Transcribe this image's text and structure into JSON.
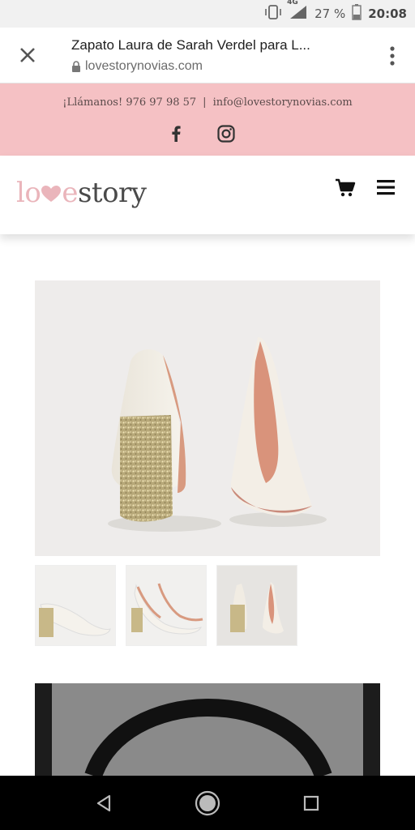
{
  "status_bar": {
    "network": "4G",
    "battery": "27 %",
    "time": "20:08"
  },
  "browser": {
    "title": "Zapato Laura de Sarah Verdel para L...",
    "url": "lovestorynovias.com"
  },
  "topbar": {
    "phone": "¡Llámanos! 976 97 98 57",
    "separator": "|",
    "email": "info@lovestorynovias.com",
    "bg_color": "#f5c1c4"
  },
  "logo": {
    "part1": "lo",
    "part2": "e",
    "part3": "story",
    "accent_color": "#eab5bb"
  },
  "gallery": {
    "thumbs": [
      "thumb-1",
      "thumb-2",
      "thumb-3"
    ],
    "selected_index": 2
  }
}
